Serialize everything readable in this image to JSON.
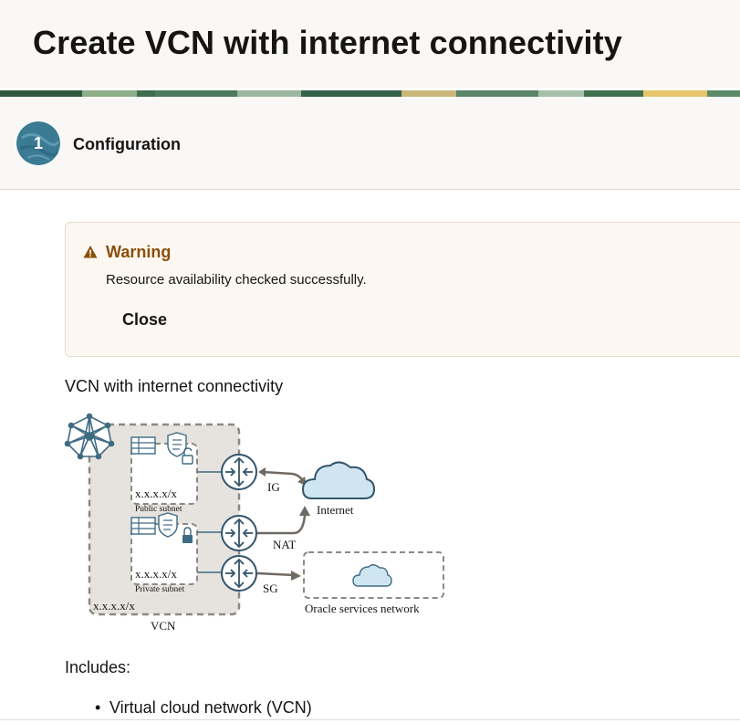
{
  "header": {
    "title": "Create VCN with internet connectivity"
  },
  "steps": [
    {
      "number": "1",
      "label": "Configuration"
    }
  ],
  "warning": {
    "title": "Warning",
    "message": "Resource availability checked successfully.",
    "close_label": "Close"
  },
  "diagram": {
    "title": "VCN with internet connectivity",
    "labels": {
      "public_cidr": "x.x.x.x/x",
      "public_subnet": "Public subnet",
      "private_cidr": "x.x.x.x/x",
      "private_subnet": "Private subnet",
      "vcn_cidr": "x.x.x.x/x",
      "vcn": "VCN",
      "ig": "IG",
      "nat": "NAT",
      "sg": "SG",
      "internet": "Internet",
      "oracle_services": "Oracle services network"
    }
  },
  "includes": {
    "title": "Includes:",
    "items": [
      "Virtual cloud network (VCN)"
    ]
  },
  "colors": {
    "accent_teal": "#3a7a93",
    "warning_text": "#8a4e0b",
    "warning_bg": "#fcf7f0",
    "cloud_fill": "#cfe6f2",
    "router_color": "#33556b"
  },
  "icons": [
    "warning-icon",
    "vcn-mesh-icon",
    "router-icon",
    "cloud-icon",
    "lock-icon",
    "unlock-icon",
    "security-list-icon",
    "route-table-icon"
  ]
}
